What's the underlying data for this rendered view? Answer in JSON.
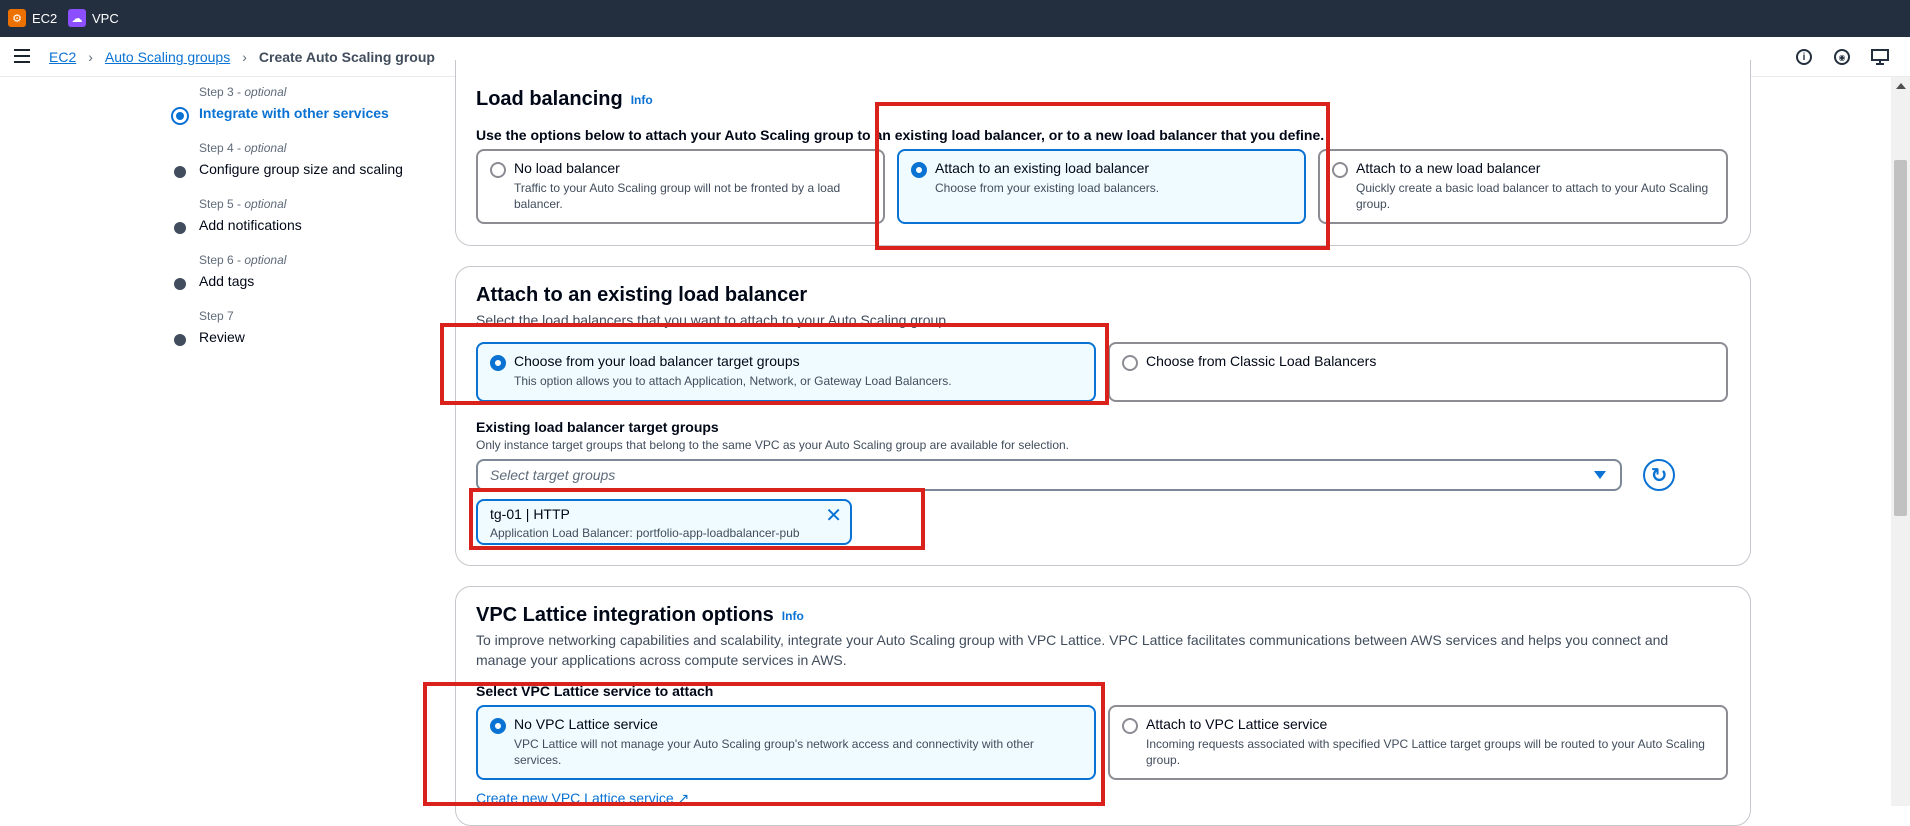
{
  "topbar": {
    "services": [
      {
        "label": "EC2",
        "icon": "ec2-icon",
        "color": "#ed7100"
      },
      {
        "label": "VPC",
        "icon": "vpc-icon",
        "color": "#8c4fff"
      }
    ]
  },
  "breadcrumb": {
    "items": [
      "EC2",
      "Auto Scaling groups"
    ],
    "current": "Create Auto Scaling group"
  },
  "header_icons": [
    "info-icon",
    "notifications-icon",
    "display-settings-icon"
  ],
  "steps": [
    {
      "label": "Step 3",
      "optional": "optional",
      "name": "Integrate with other services",
      "active": true
    },
    {
      "label": "Step 4",
      "optional": "optional",
      "name": "Configure group size and scaling",
      "active": false
    },
    {
      "label": "Step 5",
      "optional": "optional",
      "name": "Add notifications",
      "active": false
    },
    {
      "label": "Step 6",
      "optional": "optional",
      "name": "Add tags",
      "active": false
    },
    {
      "label": "Step 7",
      "optional": "",
      "name": "Review",
      "active": false
    }
  ],
  "load_balancing": {
    "title": "Load balancing",
    "info": "Info",
    "description": "Use the options below to attach your Auto Scaling group to an existing load balancer, or to a new load balancer that you define.",
    "options": [
      {
        "title": "No load balancer",
        "desc": "Traffic to your Auto Scaling group will not be fronted by a load balancer.",
        "selected": false
      },
      {
        "title": "Attach to an existing load balancer",
        "desc": "Choose from your existing load balancers.",
        "selected": true
      },
      {
        "title": "Attach to a new load balancer",
        "desc": "Quickly create a basic load balancer to attach to your Auto Scaling group.",
        "selected": false
      }
    ]
  },
  "existing_lb": {
    "title": "Attach to an existing load balancer",
    "description": "Select the load balancers that you want to attach to your Auto Scaling group.",
    "options": [
      {
        "title": "Choose from your load balancer target groups",
        "desc": "This option allows you to attach Application, Network, or Gateway Load Balancers.",
        "selected": true
      },
      {
        "title": "Choose from Classic Load Balancers",
        "desc": "",
        "selected": false
      }
    ],
    "target_groups_label": "Existing load balancer target groups",
    "target_groups_desc": "Only instance target groups that belong to the same VPC as your Auto Scaling group are available for selection.",
    "select_placeholder": "Select target groups",
    "token": {
      "title": "tg-01 | HTTP",
      "desc": "Application Load Balancer: portfolio-app-loadbalancer-pub"
    }
  },
  "lattice": {
    "title": "VPC Lattice integration options",
    "info": "Info",
    "description_line1": "To improve networking capabilities and scalability, integrate your Auto Scaling group with VPC Lattice. VPC Lattice facilitates communications between AWS services and helps you connect and",
    "description_line2": "manage your applications across compute services in AWS.",
    "select_label": "Select VPC Lattice service to attach",
    "options": [
      {
        "title": "No VPC Lattice service",
        "desc": "VPC Lattice will not manage your Auto Scaling group's network access and connectivity with other services.",
        "selected": true
      },
      {
        "title": "Attach to VPC Lattice service",
        "desc": "Incoming requests associated with specified VPC Lattice target groups will be routed to your Auto Scaling group.",
        "selected": false
      }
    ],
    "create_link": "Create new VPC Lattice service"
  },
  "annotation_color": "#d9221c"
}
